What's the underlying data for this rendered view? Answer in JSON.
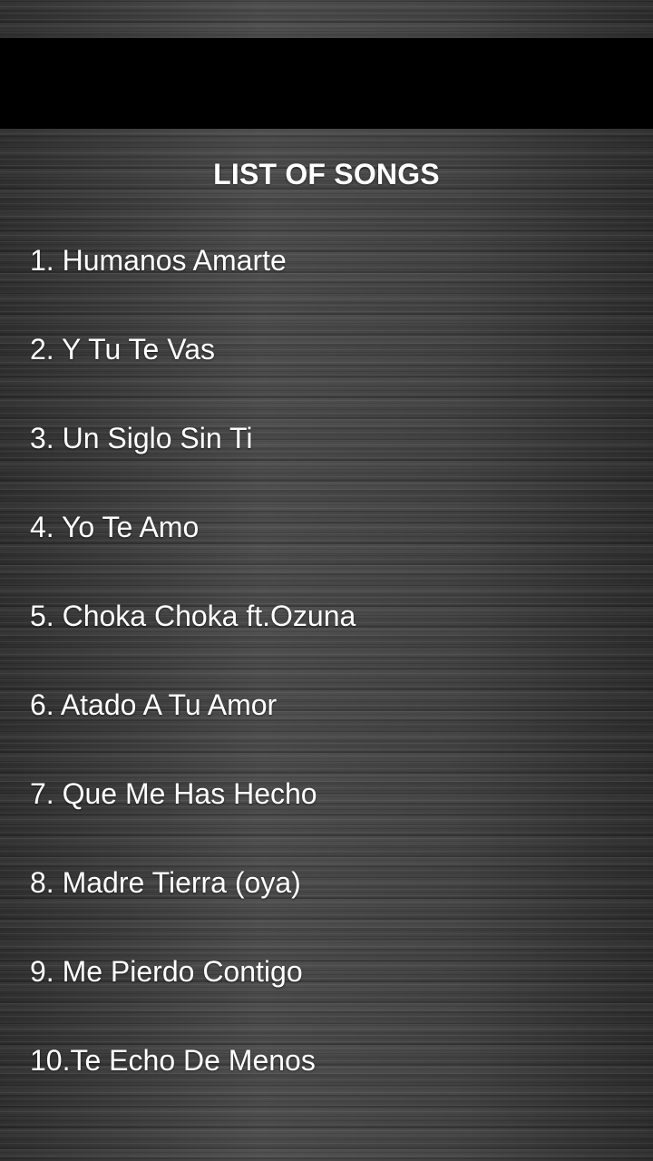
{
  "header": {
    "title": "LIST OF SONGS"
  },
  "songs": [
    {
      "label": "1. Humanos Amarte"
    },
    {
      "label": "2. Y Tu Te Vas"
    },
    {
      "label": "3. Un Siglo Sin Ti"
    },
    {
      "label": "4. Yo Te Amo"
    },
    {
      "label": "5. Choka Choka ft.Ozuna"
    },
    {
      "label": "6. Atado A Tu Amor"
    },
    {
      "label": "7. Que Me Has Hecho"
    },
    {
      "label": "8. Madre Tierra (oya)"
    },
    {
      "label": "9. Me Pierdo Contigo"
    },
    {
      "label": "10.Te Echo De Menos"
    }
  ],
  "colors": {
    "text": "#ffffff",
    "top_bar": "#000000",
    "background": "#3a3a3a"
  }
}
